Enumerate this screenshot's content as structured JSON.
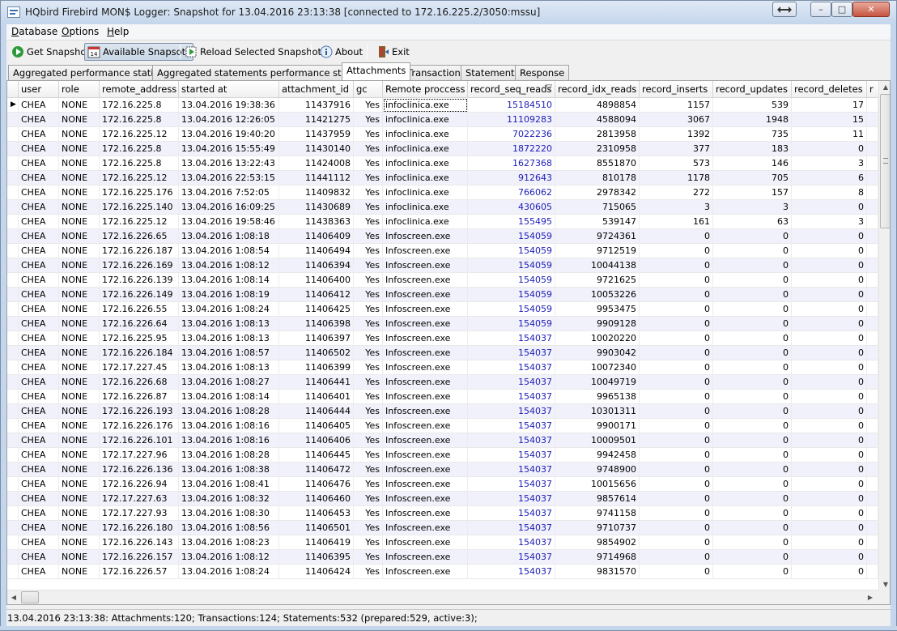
{
  "window": {
    "title": "HQbird Firebird MON$ Logger: Snapshot for 13.04.2016 23:13:38 [connected to 172.16.225.2/3050:mssu]",
    "minimize": "–",
    "maximize": "□",
    "close": "✕"
  },
  "menu": {
    "items": [
      {
        "key": "D",
        "rest": "atabase"
      },
      {
        "key": "O",
        "rest": "ptions"
      },
      {
        "key": "H",
        "rest": "elp"
      }
    ]
  },
  "toolbar": {
    "get_snapshot": "Get Snapshot",
    "available_snapshots": "Available Snapsots",
    "reload": "Reload Selected Snapshot",
    "about": "About",
    "exit": "Exit",
    "icons": [
      "get-snapshot-icon",
      "calendar-icon",
      "reload-icon",
      "info-icon",
      "exit-icon"
    ]
  },
  "tabs": [
    "Aggregated performance statistics",
    "Aggregated statements performance statistics",
    "Attachments",
    "Transactions",
    "Statements",
    "Response"
  ],
  "active_tab": "Attachments",
  "columns": [
    "user",
    "role",
    "remote_address",
    "started at",
    "attachment_id",
    "gc",
    "Remote proccess ...",
    "record_seq_reads",
    "record_idx_reads",
    "record_inserts",
    "record_updates",
    "record_deletes",
    "r"
  ],
  "sort_indicator": "▽",
  "current_row_marker": "▶",
  "rows": [
    [
      "CHEA",
      "NONE",
      "172.16.225.8",
      "13.04.2016 19:38:36",
      "11437916",
      "Yes",
      "infoclinica.exe",
      "15184510",
      "4898854",
      "1157",
      "539",
      "17"
    ],
    [
      "CHEA",
      "NONE",
      "172.16.225.8",
      "13.04.2016 12:26:05",
      "11421275",
      "Yes",
      "infoclinica.exe",
      "11109283",
      "4588094",
      "3067",
      "1948",
      "15"
    ],
    [
      "CHEA",
      "NONE",
      "172.16.225.12",
      "13.04.2016 19:40:20",
      "11437959",
      "Yes",
      "infoclinica.exe",
      "7022236",
      "2813958",
      "1392",
      "735",
      "11"
    ],
    [
      "CHEA",
      "NONE",
      "172.16.225.8",
      "13.04.2016 15:55:49",
      "11430140",
      "Yes",
      "infoclinica.exe",
      "1872220",
      "2310958",
      "377",
      "183",
      "0"
    ],
    [
      "CHEA",
      "NONE",
      "172.16.225.8",
      "13.04.2016 13:22:43",
      "11424008",
      "Yes",
      "infoclinica.exe",
      "1627368",
      "8551870",
      "573",
      "146",
      "3"
    ],
    [
      "CHEA",
      "NONE",
      "172.16.225.12",
      "13.04.2016 22:53:15",
      "11441112",
      "Yes",
      "infoclinica.exe",
      "912643",
      "810178",
      "1178",
      "705",
      "6"
    ],
    [
      "CHEA",
      "NONE",
      "172.16.225.176",
      "13.04.2016 7:52:05",
      "11409832",
      "Yes",
      "infoclinica.exe",
      "766062",
      "2978342",
      "272",
      "157",
      "8"
    ],
    [
      "CHEA",
      "NONE",
      "172.16.225.140",
      "13.04.2016 16:09:25",
      "11430689",
      "Yes",
      "infoclinica.exe",
      "430605",
      "715065",
      "3",
      "3",
      "0"
    ],
    [
      "CHEA",
      "NONE",
      "172.16.225.12",
      "13.04.2016 19:58:46",
      "11438363",
      "Yes",
      "infoclinica.exe",
      "155495",
      "539147",
      "161",
      "63",
      "3"
    ],
    [
      "CHEA",
      "NONE",
      "172.16.226.65",
      "13.04.2016 1:08:18",
      "11406409",
      "Yes",
      "Infoscreen.exe",
      "154059",
      "9724361",
      "0",
      "0",
      "0"
    ],
    [
      "CHEA",
      "NONE",
      "172.16.226.187",
      "13.04.2016 1:08:54",
      "11406494",
      "Yes",
      "Infoscreen.exe",
      "154059",
      "9712519",
      "0",
      "0",
      "0"
    ],
    [
      "CHEA",
      "NONE",
      "172.16.226.169",
      "13.04.2016 1:08:12",
      "11406394",
      "Yes",
      "Infoscreen.exe",
      "154059",
      "10044138",
      "0",
      "0",
      "0"
    ],
    [
      "CHEA",
      "NONE",
      "172.16.226.139",
      "13.04.2016 1:08:14",
      "11406400",
      "Yes",
      "Infoscreen.exe",
      "154059",
      "9721625",
      "0",
      "0",
      "0"
    ],
    [
      "CHEA",
      "NONE",
      "172.16.226.149",
      "13.04.2016 1:08:19",
      "11406412",
      "Yes",
      "Infoscreen.exe",
      "154059",
      "10053226",
      "0",
      "0",
      "0"
    ],
    [
      "CHEA",
      "NONE",
      "172.16.226.55",
      "13.04.2016 1:08:24",
      "11406425",
      "Yes",
      "Infoscreen.exe",
      "154059",
      "9953475",
      "0",
      "0",
      "0"
    ],
    [
      "CHEA",
      "NONE",
      "172.16.226.64",
      "13.04.2016 1:08:13",
      "11406398",
      "Yes",
      "Infoscreen.exe",
      "154059",
      "9909128",
      "0",
      "0",
      "0"
    ],
    [
      "CHEA",
      "NONE",
      "172.16.225.95",
      "13.04.2016 1:08:13",
      "11406397",
      "Yes",
      "Infoscreen.exe",
      "154037",
      "10020220",
      "0",
      "0",
      "0"
    ],
    [
      "CHEA",
      "NONE",
      "172.16.226.184",
      "13.04.2016 1:08:57",
      "11406502",
      "Yes",
      "Infoscreen.exe",
      "154037",
      "9903042",
      "0",
      "0",
      "0"
    ],
    [
      "CHEA",
      "NONE",
      "172.17.227.45",
      "13.04.2016 1:08:13",
      "11406399",
      "Yes",
      "Infoscreen.exe",
      "154037",
      "10072340",
      "0",
      "0",
      "0"
    ],
    [
      "CHEA",
      "NONE",
      "172.16.226.68",
      "13.04.2016 1:08:27",
      "11406441",
      "Yes",
      "Infoscreen.exe",
      "154037",
      "10049719",
      "0",
      "0",
      "0"
    ],
    [
      "CHEA",
      "NONE",
      "172.16.226.87",
      "13.04.2016 1:08:14",
      "11406401",
      "Yes",
      "Infoscreen.exe",
      "154037",
      "9965138",
      "0",
      "0",
      "0"
    ],
    [
      "CHEA",
      "NONE",
      "172.16.226.193",
      "13.04.2016 1:08:28",
      "11406444",
      "Yes",
      "Infoscreen.exe",
      "154037",
      "10301311",
      "0",
      "0",
      "0"
    ],
    [
      "CHEA",
      "NONE",
      "172.16.226.176",
      "13.04.2016 1:08:16",
      "11406405",
      "Yes",
      "Infoscreen.exe",
      "154037",
      "9900171",
      "0",
      "0",
      "0"
    ],
    [
      "CHEA",
      "NONE",
      "172.16.226.101",
      "13.04.2016 1:08:16",
      "11406406",
      "Yes",
      "Infoscreen.exe",
      "154037",
      "10009501",
      "0",
      "0",
      "0"
    ],
    [
      "CHEA",
      "NONE",
      "172.17.227.96",
      "13.04.2016 1:08:28",
      "11406445",
      "Yes",
      "Infoscreen.exe",
      "154037",
      "9942458",
      "0",
      "0",
      "0"
    ],
    [
      "CHEA",
      "NONE",
      "172.16.226.136",
      "13.04.2016 1:08:38",
      "11406472",
      "Yes",
      "Infoscreen.exe",
      "154037",
      "9748900",
      "0",
      "0",
      "0"
    ],
    [
      "CHEA",
      "NONE",
      "172.16.226.94",
      "13.04.2016 1:08:41",
      "11406476",
      "Yes",
      "Infoscreen.exe",
      "154037",
      "10015656",
      "0",
      "0",
      "0"
    ],
    [
      "CHEA",
      "NONE",
      "172.17.227.63",
      "13.04.2016 1:08:32",
      "11406460",
      "Yes",
      "Infoscreen.exe",
      "154037",
      "9857614",
      "0",
      "0",
      "0"
    ],
    [
      "CHEA",
      "NONE",
      "172.17.227.93",
      "13.04.2016 1:08:30",
      "11406453",
      "Yes",
      "Infoscreen.exe",
      "154037",
      "9741158",
      "0",
      "0",
      "0"
    ],
    [
      "CHEA",
      "NONE",
      "172.16.226.180",
      "13.04.2016 1:08:56",
      "11406501",
      "Yes",
      "Infoscreen.exe",
      "154037",
      "9710737",
      "0",
      "0",
      "0"
    ],
    [
      "CHEA",
      "NONE",
      "172.16.226.143",
      "13.04.2016 1:08:23",
      "11406419",
      "Yes",
      "Infoscreen.exe",
      "154037",
      "9854902",
      "0",
      "0",
      "0"
    ],
    [
      "CHEA",
      "NONE",
      "172.16.226.157",
      "13.04.2016 1:08:12",
      "11406395",
      "Yes",
      "Infoscreen.exe",
      "154037",
      "9714968",
      "0",
      "0",
      "0"
    ],
    [
      "CHEA",
      "NONE",
      "172.16.226.57",
      "13.04.2016 1:08:24",
      "11406424",
      "Yes",
      "Infoscreen.exe",
      "154037",
      "9831570",
      "0",
      "0",
      "0"
    ]
  ],
  "statusbar": "13.04.2016 23:13:38: Attachments:120; Transactions:124; Statements:532 (prepared:529, active:3);",
  "colors": {
    "seq_reads_text": "#1c1cb8",
    "alt_row": "#f1f1fb",
    "title_gradient_top": "#dfe9f5",
    "title_gradient_bottom": "#c4d6ec"
  }
}
